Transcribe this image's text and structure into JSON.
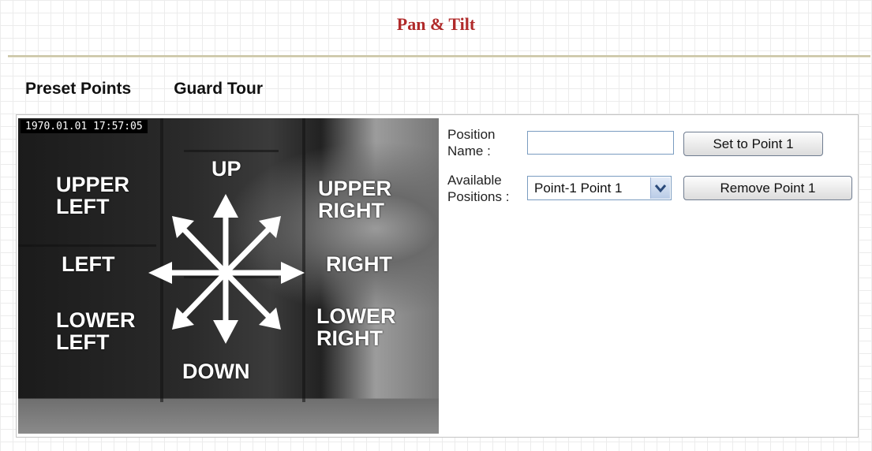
{
  "page": {
    "title": "Pan & Tilt"
  },
  "tabs": [
    "Preset Points",
    "Guard Tour"
  ],
  "video": {
    "timestamp": "1970.01.01 17:57:05",
    "directions": {
      "up": "UP",
      "upper_left_1": "UPPER",
      "upper_left_2": "LEFT",
      "upper_right_1": "UPPER",
      "upper_right_2": "RIGHT",
      "left": "LEFT",
      "right": "RIGHT",
      "lower_left_1": "LOWER",
      "lower_left_2": "LEFT",
      "lower_right_1": "LOWER",
      "lower_right_2": "RIGHT",
      "down": "DOWN"
    }
  },
  "form": {
    "position_name_label_1": "Position",
    "position_name_label_2": "Name :",
    "position_name_value": "",
    "set_button": "Set to Point 1",
    "available_label_1": "Available",
    "available_label_2": "Positions :",
    "available_selected": "Point-1  Point 1",
    "remove_button": "Remove Point 1"
  },
  "icons": {
    "arrow": "direction-arrows-icon",
    "select": "chevron-down-icon"
  },
  "colors": {
    "title": "#b02a2a",
    "input_border": "#7a9cc0"
  }
}
